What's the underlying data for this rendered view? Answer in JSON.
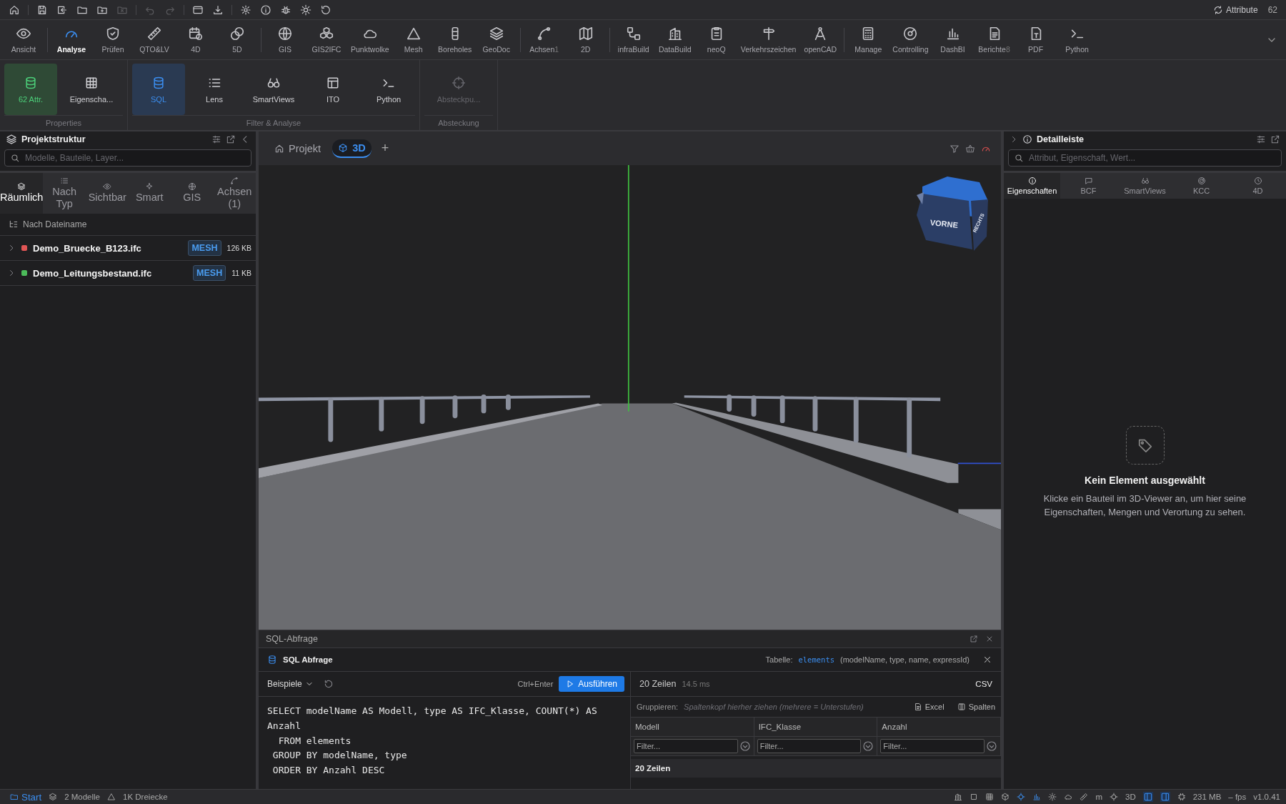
{
  "quick_actions": [
    {
      "disabled": false
    },
    {
      "disabled": false
    },
    {
      "disabled": false
    },
    {
      "disabled": false
    },
    {
      "disabled": false
    },
    {
      "disabled": true
    },
    {
      "disabled": true
    },
    {
      "disabled": true
    },
    {
      "disabled": false
    },
    {
      "disabled": false
    },
    {
      "disabled": false
    },
    {
      "disabled": false
    },
    {
      "disabled": false
    },
    {
      "disabled": false
    },
    {
      "disabled": false
    }
  ],
  "attributes": {
    "label": "Attribute",
    "count": "62"
  },
  "ribbon": {
    "groups": [
      {
        "items": [
          {
            "label": "Ansicht",
            "selected": false
          }
        ]
      },
      {
        "items": [
          {
            "label": "Analyse",
            "selected": true
          },
          {
            "label": "Prüfen",
            "selected": false
          },
          {
            "label": "QTO&LV",
            "selected": false
          },
          {
            "label": "4D",
            "selected": false
          },
          {
            "label": "5D",
            "selected": false
          }
        ]
      },
      {
        "items": [
          {
            "label": "GIS",
            "selected": false
          },
          {
            "label": "GIS2IFC",
            "selected": false
          },
          {
            "label": "Punktwolke",
            "selected": false
          },
          {
            "label": "Mesh",
            "selected": false
          },
          {
            "label": "Boreholes",
            "selected": false
          },
          {
            "label": "GeoDoc",
            "selected": false
          }
        ]
      },
      {
        "items": [
          {
            "label": "Achsen",
            "badge": "1",
            "selected": false
          },
          {
            "label": "2D",
            "selected": false
          }
        ]
      },
      {
        "items": [
          {
            "label": "infraBuild",
            "selected": false
          },
          {
            "label": "DataBuild",
            "selected": false
          },
          {
            "label": "neoQ",
            "selected": false
          },
          {
            "label": "Verkehrszeichen",
            "selected": false
          },
          {
            "label": "openCAD",
            "selected": false
          }
        ]
      },
      {
        "items": [
          {
            "label": "Manage",
            "selected": false
          },
          {
            "label": "Controlling",
            "selected": false
          },
          {
            "label": "DashBI",
            "selected": false
          },
          {
            "label": "Berichte",
            "badge": "8",
            "selected": false
          },
          {
            "label": "PDF",
            "selected": false
          },
          {
            "label": "Python",
            "selected": false
          }
        ]
      }
    ]
  },
  "subribbon": {
    "groups": [
      {
        "title": "Properties",
        "items": [
          {
            "label": "62 Attr.",
            "kind": "status",
            "selected": true,
            "disabled": false
          },
          {
            "label": "Eigenscha...",
            "kind": "tool",
            "selected": false,
            "disabled": false
          }
        ]
      },
      {
        "title": "Filter & Analyse",
        "items": [
          {
            "label": "SQL",
            "kind": "tool",
            "selected": true,
            "disabled": false
          },
          {
            "label": "Lens",
            "kind": "tool",
            "selected": false,
            "disabled": false
          },
          {
            "label": "SmartViews",
            "kind": "tool",
            "selected": false,
            "disabled": false
          },
          {
            "label": "ITO",
            "kind": "tool",
            "selected": false,
            "disabled": false
          },
          {
            "label": "Python",
            "kind": "tool",
            "selected": false,
            "disabled": false
          }
        ]
      },
      {
        "title": "Absteckung",
        "items": [
          {
            "label": "Absteckpu...",
            "kind": "tool",
            "selected": false,
            "disabled": true
          }
        ]
      }
    ]
  },
  "left_panel": {
    "title": "Projektstruktur",
    "search": {
      "placeholder": "Modelle, Bauteile, Layer..."
    },
    "tabs": [
      {
        "label": "Räumlich",
        "selected": true
      },
      {
        "label": "Nach Typ",
        "selected": false
      },
      {
        "label": "Sichtbar",
        "selected": false
      },
      {
        "label": "Smart",
        "selected": false
      },
      {
        "label": "GIS",
        "selected": false
      },
      {
        "label": "Achsen (1)",
        "selected": false
      }
    ],
    "grouping": "Nach Dateiname",
    "files": [
      {
        "name": "Demo_Bruecke_B123.ifc",
        "color": "#e05555",
        "badge": "MESH",
        "size": "126 KB"
      },
      {
        "name": "Demo_Leitungsbestand.ifc",
        "color": "#4cbb5a",
        "badge": "MESH",
        "size": "11 KB"
      }
    ]
  },
  "viewer": {
    "tabs": [
      {
        "label": "Projekt",
        "selected": false
      },
      {
        "label": "3D",
        "selected": true
      }
    ],
    "add": "+",
    "cube": {
      "front": "VORNE",
      "right": "RECHTS"
    }
  },
  "sql_panel": {
    "title": "SQL-Abfrage",
    "header": "SQL Abfrage",
    "table_label": "Tabelle:",
    "table_name": "elements",
    "table_columns": "(modelName, type, name, expressId)",
    "examples": "Beispiele",
    "shortcut": "Ctrl+Enter",
    "run": "Ausführen",
    "query": "SELECT modelName AS Modell, type AS IFC_Klasse, COUNT(*) AS Anzahl\n  FROM elements\n GROUP BY modelName, type\n ORDER BY Anzahl DESC",
    "result_count": "20 Zeilen",
    "duration": "14.5 ms",
    "csv": "CSV",
    "group_label": "Gruppieren:",
    "group_hint": "Spaltenkopf hierher ziehen (mehrere = Unterstufen)",
    "excel": "Excel",
    "columns_button": "Spalten",
    "columns": [
      {
        "name": "Modell",
        "filter_placeholder": "Filter..."
      },
      {
        "name": "IFC_Klasse",
        "filter_placeholder": "Filter..."
      },
      {
        "name": "Anzahl",
        "filter_placeholder": "Filter..."
      }
    ],
    "group_row": "20 Zeilen"
  },
  "right_panel": {
    "title": "Detailleiste",
    "search": {
      "placeholder": "Attribut, Eigenschaft, Wert..."
    },
    "tabs": [
      {
        "label": "Eigenschaften",
        "selected": true
      },
      {
        "label": "BCF",
        "selected": false
      },
      {
        "label": "SmartViews",
        "selected": false
      },
      {
        "label": "KCC",
        "selected": false
      },
      {
        "label": "4D",
        "selected": false
      }
    ],
    "empty_title": "Kein Element ausgewählt",
    "empty_text": "Klicke ein Bauteil im 3D-Viewer an, um hier seine Eigenschaften, Mengen und Verortung zu sehen."
  },
  "status_bar": {
    "start": "Start",
    "models": "2 Modelle",
    "triangles": "1K Dreiecke",
    "tools": [
      {
        "active": false
      },
      {
        "active": false
      },
      {
        "active": false
      },
      {
        "active": false
      },
      {
        "active": true
      },
      {
        "active": true
      },
      {
        "active": false
      },
      {
        "active": false
      },
      {
        "active": false
      }
    ],
    "unit": "m",
    "view_mode": "3D",
    "panels": [
      {
        "active": true
      },
      {
        "active": true
      }
    ],
    "memory": "231 MB",
    "fps": "– fps",
    "version": "v1.0.41"
  }
}
